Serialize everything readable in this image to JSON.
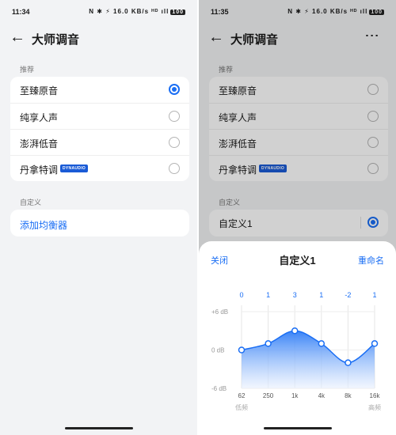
{
  "left": {
    "status": {
      "time": "11:34",
      "icons": "N ✱ ⚡ 16.0 KB/s ᴴᴰ ıll",
      "battery": "100"
    },
    "header": {
      "title": "大师调音"
    },
    "recommend": {
      "section_label": "推荐",
      "items": [
        {
          "label": "至臻原音",
          "selected": true
        },
        {
          "label": "纯享人声",
          "selected": false
        },
        {
          "label": "澎湃低音",
          "selected": false
        },
        {
          "label": "丹拿特调",
          "selected": false,
          "badge": "DYNAUDIO"
        }
      ]
    },
    "custom": {
      "section_label": "自定义",
      "add_label": "添加均衡器"
    }
  },
  "right": {
    "status": {
      "time": "11:35",
      "icons": "N ✱ ⚡ 16.0 KB/s ᴴᴰ ıll",
      "battery": "100"
    },
    "header": {
      "title": "大师调音",
      "more": "⋮"
    },
    "recommend": {
      "section_label": "推荐",
      "items": [
        {
          "label": "至臻原音",
          "selected": false
        },
        {
          "label": "纯享人声",
          "selected": false
        },
        {
          "label": "澎湃低音",
          "selected": false
        },
        {
          "label": "丹拿特调",
          "selected": false,
          "badge": "DYNAUDIO"
        }
      ]
    },
    "custom": {
      "section_label": "自定义",
      "item_label": "自定义1",
      "selected": true
    },
    "sheet": {
      "close_label": "关闭",
      "title": "自定义1",
      "rename_label": "重命名",
      "accent": "#1a6ef4"
    }
  },
  "chart_data": {
    "type": "line",
    "x": [
      "62",
      "250",
      "1k",
      "4k",
      "8k",
      "16k"
    ],
    "values": [
      0,
      1,
      3,
      1,
      -2,
      1
    ],
    "value_labels": [
      "0",
      "1",
      "3",
      "1",
      "-2",
      "1"
    ],
    "y_tick_labels": [
      "+6 dB",
      "0 dB",
      "-6 dB"
    ],
    "ylim": [
      -6,
      6
    ],
    "x_end_labels": [
      "低频",
      "高频"
    ],
    "title": "",
    "xlabel": "",
    "ylabel": "",
    "fill": true,
    "colors": {
      "line": "#1a6ef4",
      "fill_top": "#2f7df6",
      "fill_bottom": "#e8f0fe"
    }
  }
}
